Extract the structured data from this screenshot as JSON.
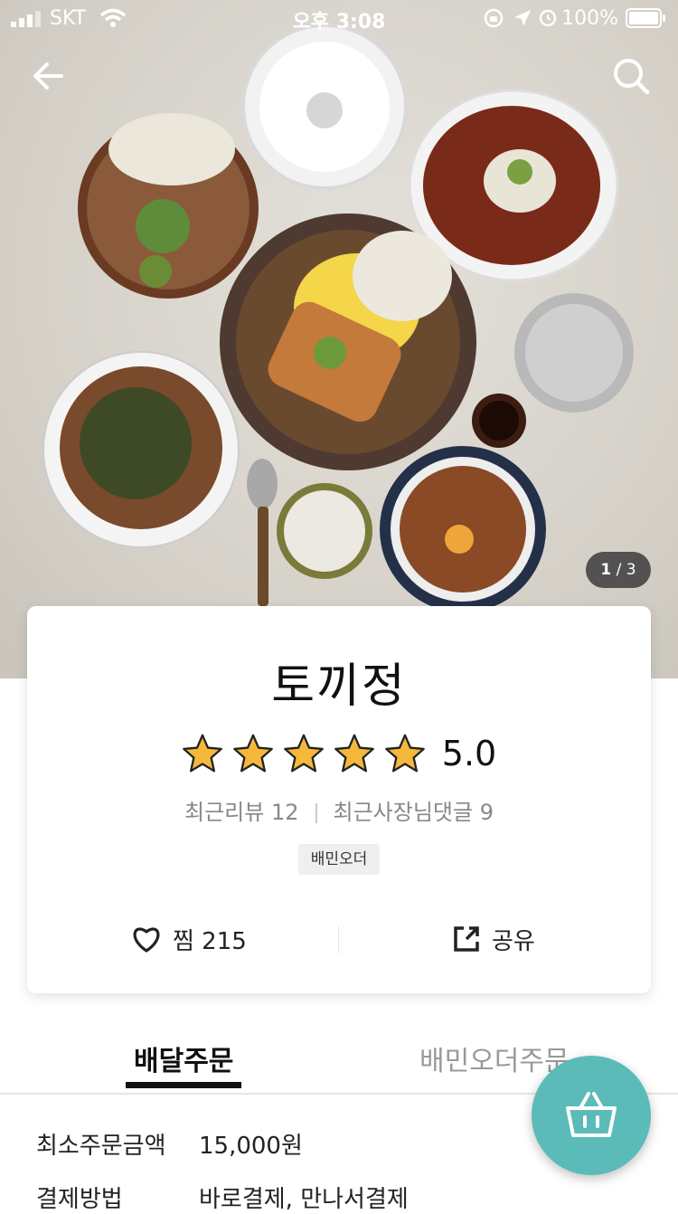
{
  "status_bar": {
    "carrier": "SKT",
    "time": "오후 3:08",
    "battery": "100%"
  },
  "nav": {
    "back_icon": "arrow-left-icon",
    "search_icon": "search-icon"
  },
  "gallery": {
    "current": "1",
    "total": "3",
    "separator": "/"
  },
  "store": {
    "name": "토끼정",
    "rating": 5.0,
    "rating_text": "5.0",
    "recent_reviews": "최근리뷰 12",
    "owner_replies": "최근사장님댓글 9",
    "badge": "배민오더"
  },
  "actions": {
    "like_label": "찜 215",
    "share_label": "공유"
  },
  "tabs": [
    {
      "label": "배달주문",
      "active": true
    },
    {
      "label": "배민오더주문",
      "active": false
    }
  ],
  "info": [
    {
      "key": "최소주문금액",
      "value": "15,000원"
    },
    {
      "key": "결제방법",
      "value": "바로결제, 만나서결제"
    }
  ],
  "fab": {
    "icon": "basket-icon"
  },
  "colors": {
    "accent": "#5bbbb8",
    "star": "#f5b83a"
  }
}
